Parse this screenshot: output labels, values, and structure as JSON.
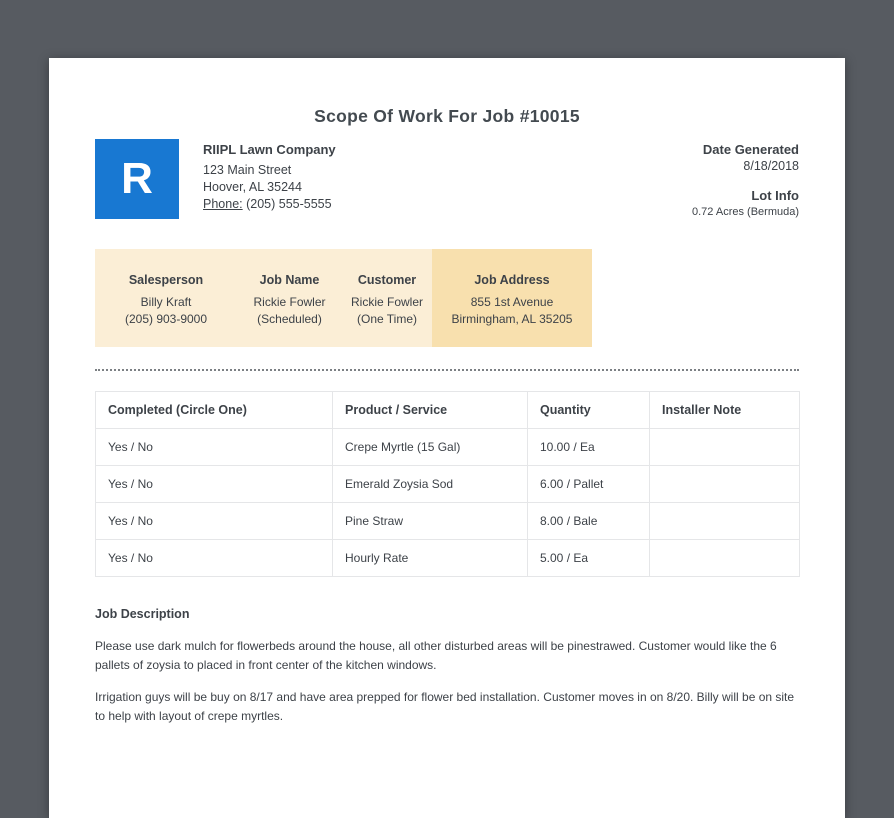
{
  "page": {
    "title": "Scope Of Work For Job #10015"
  },
  "company": {
    "logo_letter": "R",
    "name": "RIIPL Lawn Company",
    "address_line1": "123 Main Street",
    "address_line2": "Hoover, AL 35244",
    "phone_label": "Phone:",
    "phone": "(205) 555-5555"
  },
  "meta": {
    "date_generated_label": "Date Generated",
    "date_generated": "8/18/2018",
    "lot_info_label": "Lot Info",
    "lot_info": "0.72 Acres (Bermuda)"
  },
  "info_bar": {
    "columns": [
      {
        "label": "Salesperson",
        "line1": "Billy Kraft",
        "line2": "(205) 903-9000"
      },
      {
        "label": "Job Name",
        "line1": "Rickie Fowler",
        "line2": "(Scheduled)"
      },
      {
        "label": "Customer",
        "line1": "Rickie Fowler",
        "line2": "(One Time)"
      },
      {
        "label": "Job Address",
        "line1": "855 1st Avenue",
        "line2": "Birmingham, AL 35205"
      }
    ]
  },
  "work_table": {
    "headers": [
      "Completed (Circle One)",
      "Product / Service",
      "Quantity",
      "Installer Note"
    ],
    "rows": [
      {
        "completed": "Yes / No",
        "product": "Crepe Myrtle (15 Gal)",
        "quantity": "10.00 / Ea",
        "note": ""
      },
      {
        "completed": "Yes / No",
        "product": "Emerald Zoysia Sod",
        "quantity": "6.00 / Pallet",
        "note": ""
      },
      {
        "completed": "Yes / No",
        "product": "Pine Straw",
        "quantity": "8.00 / Bale",
        "note": ""
      },
      {
        "completed": "Yes / No",
        "product": "Hourly Rate",
        "quantity": "5.00 / Ea",
        "note": ""
      }
    ]
  },
  "job_description": {
    "heading": "Job Description",
    "paragraphs": [
      "Please use dark mulch for flowerbeds around the house, all other disturbed areas will be pinestrawed. Customer would like the 6 pallets of zoysia to placed in front center of the kitchen windows.",
      "Irrigation guys will be buy on 8/17 and have area prepped for flower bed installation. Customer moves in on 8/20. Billy will be on site to help with layout of crepe myrtles."
    ]
  },
  "colors": {
    "background": "#575b61",
    "accent_blue": "#1878d2",
    "bar_bg": "#fbeed6",
    "bar_highlight": "#f8e0ae"
  }
}
